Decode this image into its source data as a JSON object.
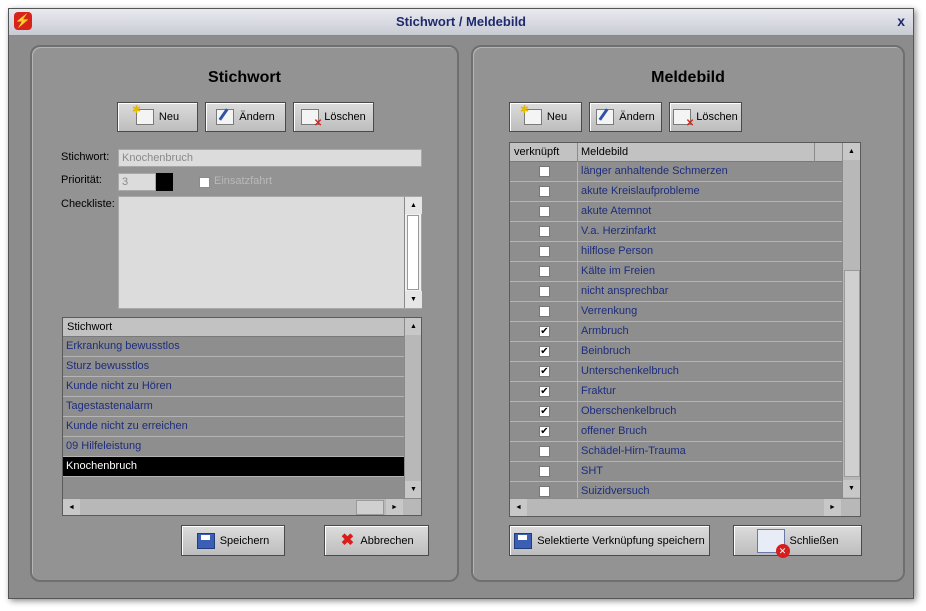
{
  "window": {
    "title": "Stichwort / Meldebild",
    "close_glyph": "x"
  },
  "left": {
    "title": "Stichwort",
    "buttons": {
      "new": "Neu",
      "edit": "Ändern",
      "delete": "Löschen"
    },
    "form": {
      "stichwort_label": "Stichwort:",
      "stichwort_value": "Knochenbruch",
      "prioritaet_label": "Priorität:",
      "prioritaet_value": "3",
      "einsatzfahrt_label": "Einsatzfahrt",
      "checkliste_label": "Checkliste:",
      "checkliste_value": ""
    },
    "grid": {
      "header": "Stichwort",
      "rows": [
        "Erkrankung bewusstlos",
        "Sturz bewusstlos",
        "Kunde nicht zu Hören",
        "Tagestastenalarm",
        "Kunde nicht zu erreichen",
        "09 Hilfeleistung",
        "Knochenbruch"
      ],
      "selected_index": 6
    },
    "save_button": "Speichern",
    "cancel_button": "Abbrechen"
  },
  "right": {
    "title": "Meldebild",
    "buttons": {
      "new": "Neu",
      "edit": "Ändern",
      "delete": "Löschen"
    },
    "grid": {
      "headers": {
        "linked": "verknüpft",
        "name": "Meldebild"
      },
      "rows": [
        {
          "name": "länger anhaltende Schmerzen",
          "checked": false
        },
        {
          "name": "akute Kreislaufprobleme",
          "checked": false
        },
        {
          "name": "akute Atemnot",
          "checked": false
        },
        {
          "name": "V.a. Herzinfarkt",
          "checked": false
        },
        {
          "name": "hilflose Person",
          "checked": false
        },
        {
          "name": "Kälte im Freien",
          "checked": false
        },
        {
          "name": "nicht ansprechbar",
          "checked": false
        },
        {
          "name": "Verrenkung",
          "checked": false
        },
        {
          "name": "Armbruch",
          "checked": true
        },
        {
          "name": "Beinbruch",
          "checked": true
        },
        {
          "name": "Unterschenkelbruch",
          "checked": true
        },
        {
          "name": "Fraktur",
          "checked": true
        },
        {
          "name": "Oberschenkelbruch",
          "checked": true
        },
        {
          "name": "offener Bruch",
          "checked": true
        },
        {
          "name": "Schädel-Hirn-Trauma",
          "checked": false
        },
        {
          "name": "SHT",
          "checked": false
        },
        {
          "name": "Suizidversuch",
          "checked": false
        }
      ]
    },
    "save_link_button": "Selektierte Verknüpfung speichern",
    "close_button": "Schließen"
  },
  "colors": {
    "window_bg": "#8c8c8c",
    "row_text": "#1d2d7e",
    "selected_row": "#000000",
    "title_text": "#1f2a6e",
    "priority_swatch": "#000000"
  },
  "icons": {
    "app": "app-icon",
    "new": "new-document-icon",
    "edit": "edit-pencil-icon",
    "delete": "delete-icon",
    "save": "floppy-disk-icon",
    "cancel": "cancel-x-icon",
    "close": "close-window-icon"
  }
}
